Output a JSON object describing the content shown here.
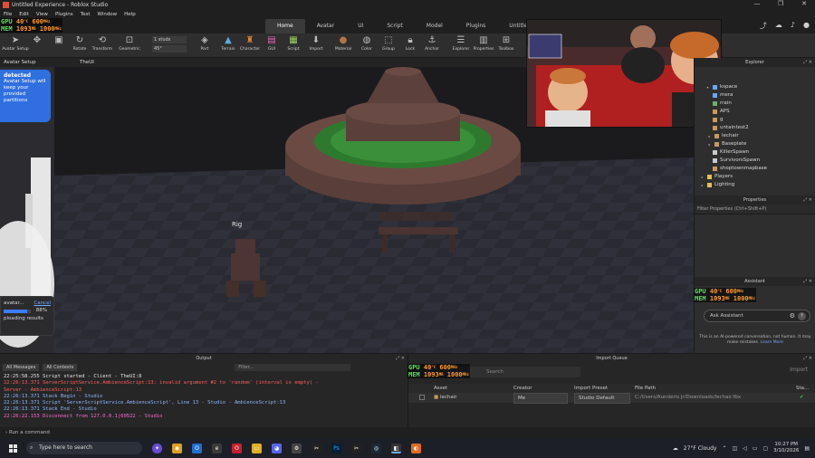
{
  "window": {
    "title": "Untitled Experience - Roblox Studio",
    "controls": [
      "—",
      "❐",
      "✕"
    ]
  },
  "menu": [
    "File",
    "Edit",
    "View",
    "Plugins",
    "Test",
    "Window",
    "Help"
  ],
  "ribbon_tabs": [
    {
      "label": "Home",
      "active": true
    },
    {
      "label": "Avatar",
      "active": false
    },
    {
      "label": "UI",
      "active": false
    },
    {
      "label": "Script",
      "active": false
    },
    {
      "label": "Model",
      "active": false
    },
    {
      "label": "Plugins",
      "active": false
    },
    {
      "label": "Untitled",
      "active": false
    }
  ],
  "toolbar": {
    "avatar_setup": "Avatar Setup",
    "tools": [
      "Rotate",
      "Transform",
      "Geometric",
      "Part",
      "Terrain",
      "Character",
      "GUI",
      "Script",
      "Import",
      "Material",
      "Color",
      "Group",
      "Lock",
      "Anchor",
      "Explorer",
      "Properties",
      "Toolbox"
    ],
    "move_increment": "1 studs",
    "rotate_increment": "45°"
  },
  "doc_tabs": {
    "left": "Avatar Setup",
    "main": "TheUI"
  },
  "viewport": {
    "rig_label": "Rig"
  },
  "avatar_popup": {
    "heading": "detected",
    "body": "Avatar Setup will keep your provided partitions"
  },
  "progress_card": {
    "title": "avatar...",
    "cancel": "Cancel",
    "percent_text": "88%",
    "percent": 0.88,
    "status": "ploading results"
  },
  "hw_overlay": {
    "gpu_label": "GPU",
    "mem_label": "MEM",
    "gpu_temp": "40",
    "gpu_temp_unit": "°C",
    "gpu_clock": "600",
    "gpu_clock_unit": "MHz",
    "mem_used": "1093",
    "mem_used_unit": "MB",
    "mem_clock": "1000",
    "mem_clock_unit": "MHz"
  },
  "explorer": {
    "title": "Explorer",
    "items": [
      {
        "label": "kspace",
        "color": "#6aa6ff",
        "depth": 0,
        "expanded": true
      },
      {
        "label": "mera",
        "color": "#6aa6ff",
        "depth": 1
      },
      {
        "label": "rrain",
        "color": "#6ab06a",
        "depth": 1
      },
      {
        "label": "APS",
        "color": "#c79a5a",
        "depth": 1
      },
      {
        "label": "g",
        "color": "#c79a5a",
        "depth": 1
      },
      {
        "label": "untaintest2",
        "color": "#c79a5a",
        "depth": 1
      },
      {
        "label": "lechair",
        "color": "#c79a5a",
        "depth": 1
      },
      {
        "label": "Baseplate",
        "color": "#c79a5a",
        "depth": 1
      },
      {
        "label": "KillerSpawn",
        "color": "#c9c9c9",
        "depth": 1
      },
      {
        "label": "SurvivorsSpawn",
        "color": "#c9c9c9",
        "depth": 1
      },
      {
        "label": "shoptownmapbase",
        "color": "#c79a5a",
        "depth": 1
      },
      {
        "label": "Players",
        "color": "#e6c14a",
        "depth": 0
      },
      {
        "label": "Lighting",
        "color": "#e6c14a",
        "depth": 0
      }
    ]
  },
  "properties": {
    "title": "Properties",
    "filter_placeholder": "Filter Properties (Ctrl+Shift+P)"
  },
  "assistant": {
    "title": "Assistant",
    "input_placeholder": "Ask Assistant",
    "disclaimer": "This is an AI-powered conversation, not human. It may make mistakes.",
    "learn_more": "Learn More"
  },
  "output": {
    "title": "Output",
    "filter_messages": "All Messages",
    "filter_contexts": "All Contexts",
    "filter_placeholder": "Filter...",
    "lines": [
      {
        "text": "22:25:58.255  Script started  -  Client - TheUI:8",
        "kind": "warn"
      },
      {
        "text": "22:26:13.371  ServerScriptService.AmbienceScript:13: invalid argument #2 to 'random' (interval is empty)  -",
        "kind": "err"
      },
      {
        "text": "Server - AmbienceScript:13",
        "kind": "warn"
      },
      {
        "text": "22:26:13.371  Stack Begin  -  Studio",
        "kind": "info"
      },
      {
        "text": "22:26:13.371  Script 'ServerScriptService.AmbienceScript', Line 13  -  Studio - AmbienceScript:13",
        "kind": "info"
      },
      {
        "text": "22:26:13.371  Stack End  -  Studio",
        "kind": "info"
      },
      {
        "text": "22:26:22.153  Disconnect from 127.0.0.1|60522  -  Studio",
        "kind": "disc"
      }
    ]
  },
  "import_queue": {
    "title": "Import Queue",
    "search_placeholder": "Search",
    "import_button": "Import",
    "columns": [
      "Asset",
      "Creator",
      "Import Preset",
      "File Path",
      "Sta..."
    ],
    "row": {
      "asset": "lechair",
      "creator": "Me",
      "preset": "Studio Default",
      "path": "C:/Users/Aunderis Jr/Downloads/lechair.fbx"
    }
  },
  "command_bar": {
    "placeholder": "Run a command"
  },
  "taskbar": {
    "search_placeholder": "Type here to search",
    "weather": "27°F  Cloudy",
    "time": "10:27 PM",
    "date": "3/10/2026"
  }
}
